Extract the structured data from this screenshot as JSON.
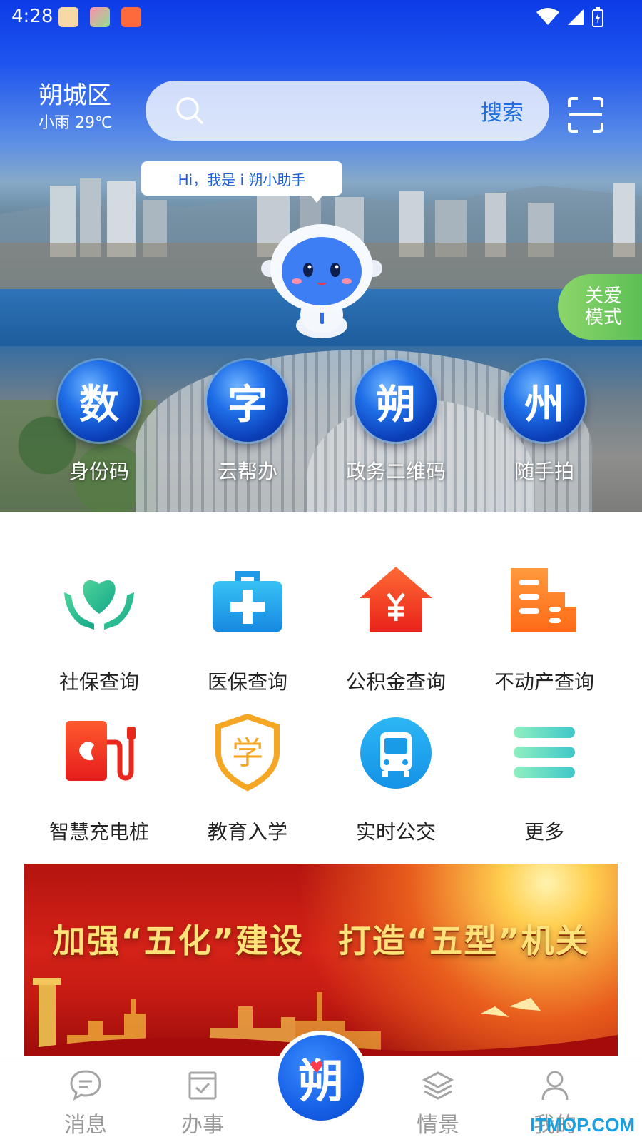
{
  "status_bar": {
    "time": "4:28"
  },
  "location": {
    "district": "朔城区",
    "weather": "小雨 29℃"
  },
  "search": {
    "placeholder": "",
    "button_label": "搜索"
  },
  "assistant": {
    "greeting": "Hi，我是 i 朔小助手"
  },
  "care_mode": {
    "line1": "关爱",
    "line2": "模式"
  },
  "quick_actions": [
    {
      "glyph": "数",
      "label": "身份码"
    },
    {
      "glyph": "字",
      "label": "云帮办"
    },
    {
      "glyph": "朔",
      "label": "政务二维码"
    },
    {
      "glyph": "州",
      "label": "随手拍"
    }
  ],
  "services": [
    {
      "label": "社保查询",
      "icon": "heart-hands-icon"
    },
    {
      "label": "医保查询",
      "icon": "medical-kit-icon"
    },
    {
      "label": "公积金查询",
      "icon": "house-yuan-icon"
    },
    {
      "label": "不动产查询",
      "icon": "building-icon"
    },
    {
      "label": "智慧充电桩",
      "icon": "charging-pile-icon"
    },
    {
      "label": "教育入学",
      "icon": "education-shield-icon"
    },
    {
      "label": "实时公交",
      "icon": "bus-icon"
    },
    {
      "label": "更多",
      "icon": "more-icon"
    }
  ],
  "education_glyph": "学",
  "banner": {
    "text": "加强“五化”建设　打造“五型”机关"
  },
  "bottom_nav": [
    {
      "label": "消息",
      "icon": "message-icon"
    },
    {
      "label": "办事",
      "icon": "task-icon"
    },
    {
      "label": "情景",
      "icon": "layers-icon"
    },
    {
      "label": "我的",
      "icon": "profile-icon"
    }
  ],
  "center_nav": {
    "glyph": "朔"
  },
  "watermark": "ITMOP.COM",
  "colors": {
    "primary": "#1f6fe0",
    "care_green": "#6ccb5f",
    "banner_red": "#c81c14",
    "banner_gold": "#ffe27a"
  }
}
